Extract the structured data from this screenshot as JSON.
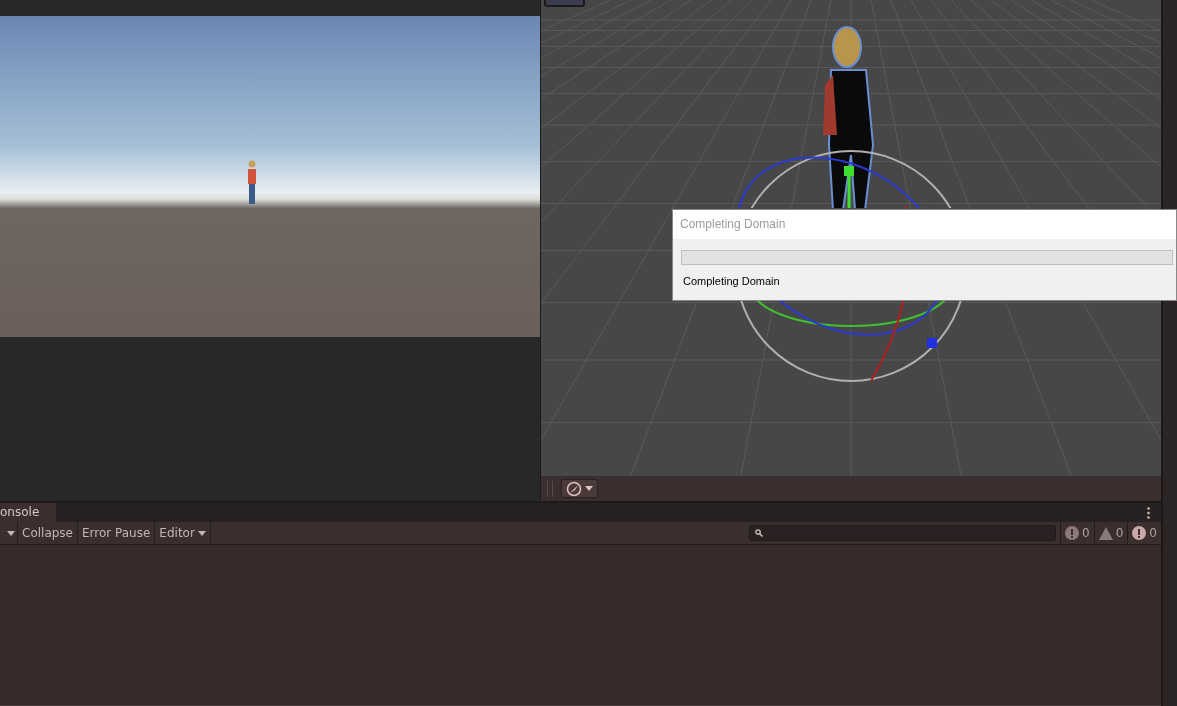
{
  "console": {
    "tab": {
      "label": "onsole",
      "selected": true
    },
    "toolbar": {
      "buttons": [
        {
          "label": "Collapse",
          "kind": "toggle"
        },
        {
          "label": "Error Pause",
          "kind": "toggle"
        },
        {
          "label": "Editor",
          "kind": "dropdown"
        }
      ]
    },
    "counters": [
      {
        "kind": "log",
        "count": "0"
      },
      {
        "kind": "warning",
        "count": "0"
      },
      {
        "kind": "error",
        "count": "0"
      }
    ]
  },
  "dialog": {
    "title": "Completing Domain",
    "progress": {
      "level": 0
    },
    "message": "Completing Domain"
  }
}
